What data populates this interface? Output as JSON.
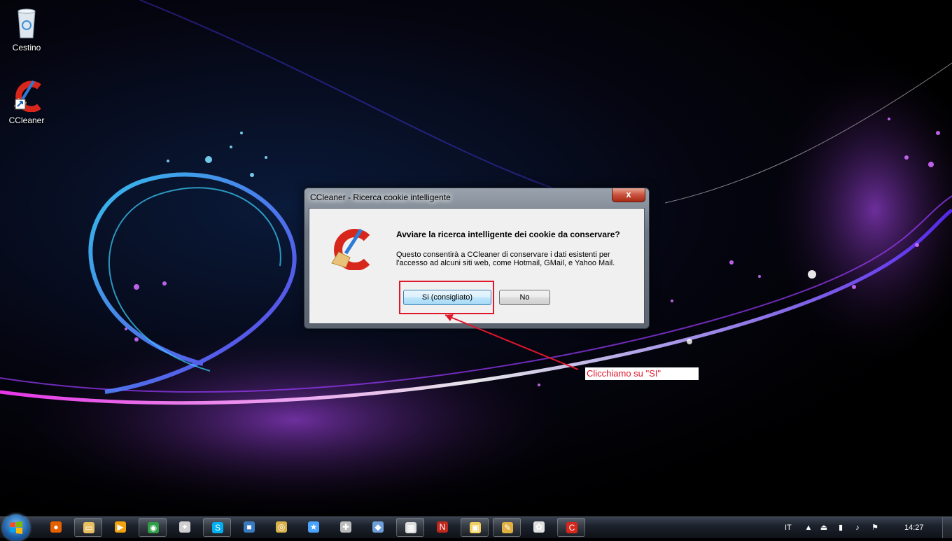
{
  "desktop": {
    "icons": [
      {
        "label": "Cestino",
        "icon": "recycle-bin-icon"
      },
      {
        "label": "CCleaner",
        "icon": "ccleaner-icon"
      }
    ]
  },
  "dialog": {
    "title": "CCleaner - Ricerca cookie intelligente",
    "close_label": "x",
    "heading": "Avviare la ricerca intelligente dei cookie da conservare?",
    "message": "Questo consentirà a CCleaner di conservare i dati esistenti per l'accesso ad alcuni siti web, come Hotmail, GMail, e Yahoo Mail.",
    "yes_label": "Si (consigliato)",
    "no_label": "No"
  },
  "annotation": {
    "callout_text": "Clicchiamo su \"SI\"",
    "color": "#e0162b"
  },
  "taskbar": {
    "apps": [
      {
        "name": "firefox",
        "icon": "firefox-icon",
        "color": "#e66000"
      },
      {
        "name": "explorer",
        "icon": "folder-icon",
        "color": "#e8c060"
      },
      {
        "name": "media-player",
        "icon": "media-player-icon",
        "color": "#f2a20c"
      },
      {
        "name": "chrome",
        "icon": "chrome-icon",
        "color": "#2e9e48"
      },
      {
        "name": "app-5",
        "icon": "usb-icon",
        "color": "#cfcfcf"
      },
      {
        "name": "skype",
        "icon": "skype-icon",
        "color": "#00aff0"
      },
      {
        "name": "app-7",
        "icon": "game-icon",
        "color": "#3a7bbf"
      },
      {
        "name": "app-8",
        "icon": "spiral-icon",
        "color": "#d9b24a"
      },
      {
        "name": "app-9",
        "icon": "star-icon",
        "color": "#4aa3ff"
      },
      {
        "name": "app-10",
        "icon": "gamepad-icon",
        "color": "#bbbbbb"
      },
      {
        "name": "app-11",
        "icon": "steam-icon",
        "color": "#6f9fd8"
      },
      {
        "name": "app-12",
        "icon": "calendar-icon",
        "color": "#dddddd"
      },
      {
        "name": "app-13",
        "icon": "n-logo-icon",
        "color": "#c0281e"
      },
      {
        "name": "app-14",
        "icon": "chat-icon",
        "color": "#f0d060"
      },
      {
        "name": "app-15",
        "icon": "tools-icon",
        "color": "#e0b040"
      },
      {
        "name": "app-16",
        "icon": "paint-icon",
        "color": "#e0e0e0"
      },
      {
        "name": "ccleaner",
        "icon": "ccleaner-icon",
        "color": "#d7261c"
      }
    ],
    "language": "IT",
    "clock": "14:27"
  }
}
